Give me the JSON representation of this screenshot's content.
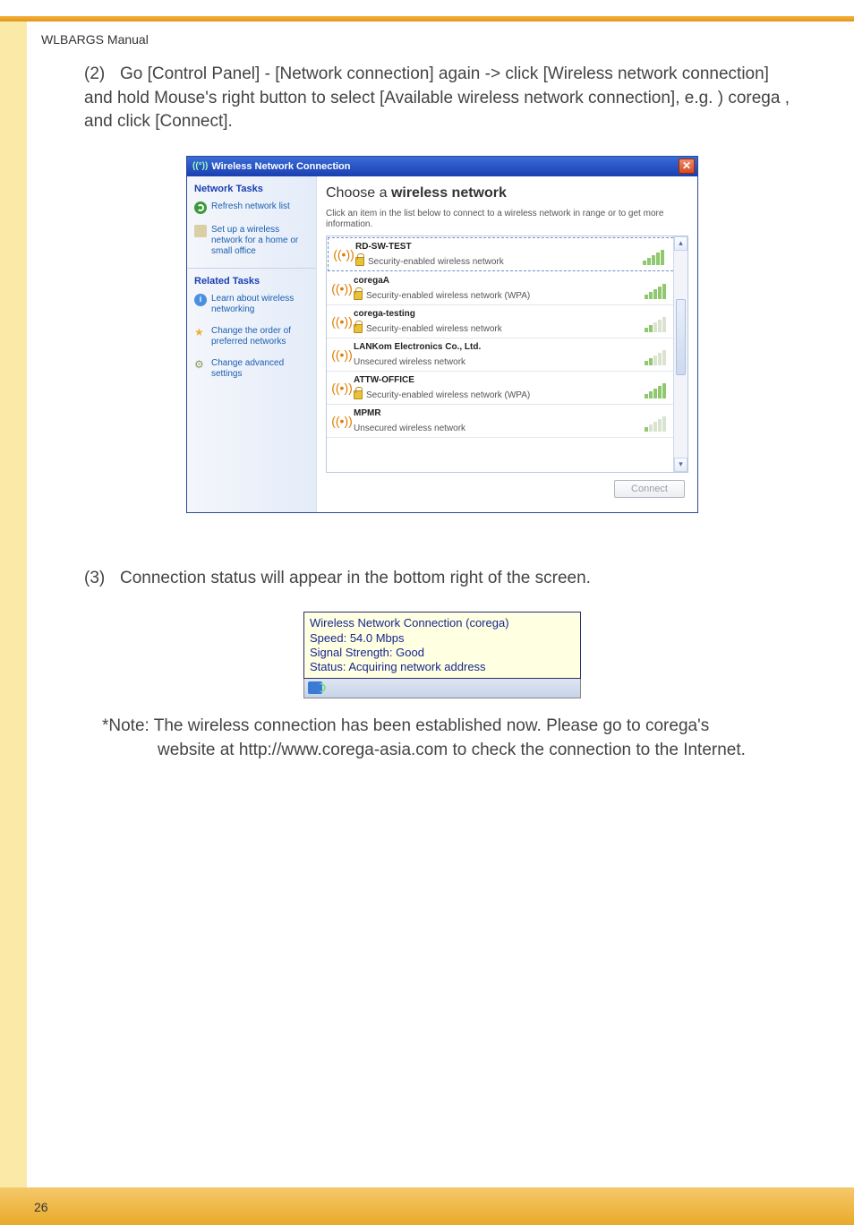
{
  "doc_header": "WLBARGS Manual",
  "page_number": "26",
  "step2": {
    "marker": "(2)",
    "text": "Go [Control Panel] - [Network connection] again -> click [Wireless network connection] and hold Mouse's right button to select [Available wireless network connection],  e.g. ) corega , and click [Connect]."
  },
  "dialog": {
    "title": "Wireless Network Connection",
    "sidebar": {
      "network_tasks_header": "Network Tasks",
      "refresh": "Refresh network list",
      "setup": "Set up a wireless network for a home or small office",
      "related_header": "Related Tasks",
      "learn": "Learn about wireless networking",
      "order": "Change the order of preferred networks",
      "advanced": "Change advanced settings"
    },
    "main": {
      "heading_pre": "Choose a ",
      "heading_bold": "wireless network",
      "subtext": "Click an item in the list below to connect to a wireless network in range or to get more information.",
      "networks": [
        {
          "ssid": "RD-SW-TEST",
          "security": "Security-enabled wireless network",
          "lock": true,
          "strength": "mid"
        },
        {
          "ssid": "coregaA",
          "security": "Security-enabled wireless network (WPA)",
          "lock": true,
          "strength": "high"
        },
        {
          "ssid": "corega-testing",
          "security": "Security-enabled wireless network",
          "lock": true,
          "strength": "low"
        },
        {
          "ssid": "LANKom Electronics Co., Ltd.",
          "security": "Unsecured wireless network",
          "lock": false,
          "strength": "low"
        },
        {
          "ssid": "ATTW-OFFICE",
          "security": "Security-enabled wireless network (WPA)",
          "lock": true,
          "strength": "high"
        },
        {
          "ssid": "MPMR",
          "security": "Unsecured wireless network",
          "lock": false,
          "strength": "vlow"
        }
      ],
      "connect_button": "Connect"
    }
  },
  "step3": {
    "marker": "(3)",
    "text": "Connection status will appear in the bottom right of the screen."
  },
  "tooltip": {
    "line1": "Wireless Network Connection (corega)",
    "line2": "Speed: 54.0 Mbps",
    "line3": "Signal Strength: Good",
    "line4": "Status: Acquiring network address"
  },
  "note": {
    "prefix": "*Note:",
    "line1": "The wireless connection has been established now. Please go to corega's",
    "line2": "website at http://www.corega-asia.com to check the connection to the Internet."
  }
}
